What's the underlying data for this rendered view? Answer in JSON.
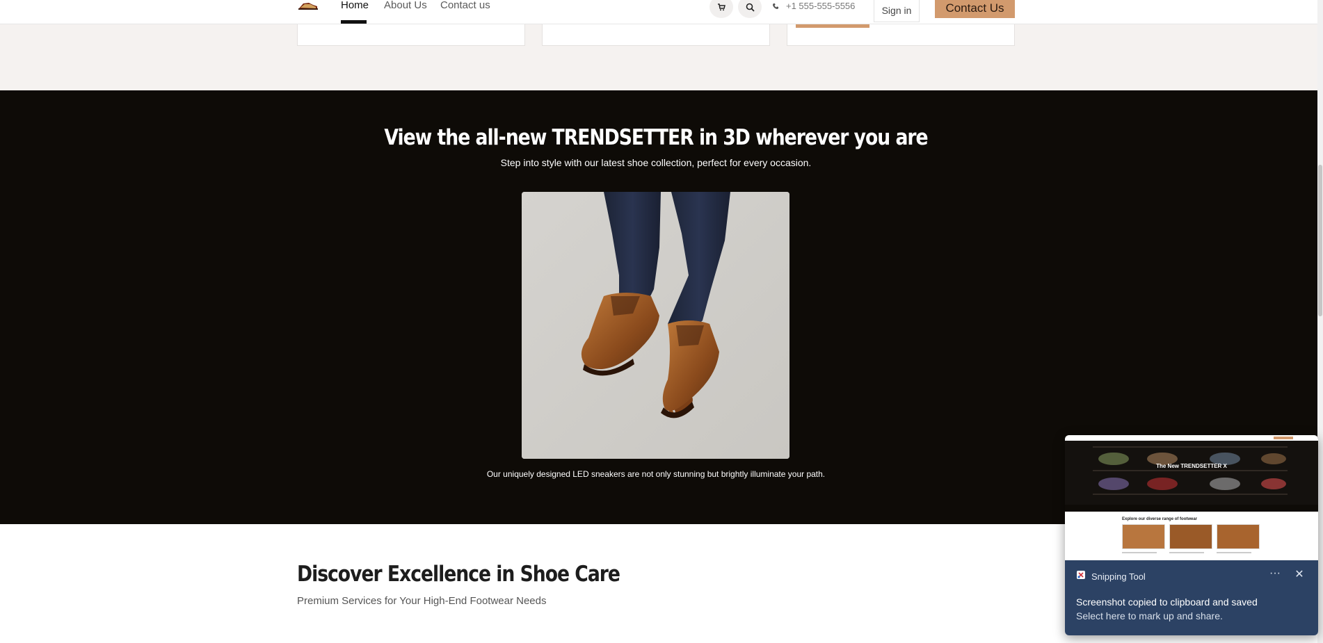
{
  "header": {
    "nav": [
      {
        "label": "Home"
      },
      {
        "label": "About Us"
      },
      {
        "label": "Contact us"
      }
    ],
    "phone": "+1 555-555-5556",
    "signin_label": "Sign in",
    "contact_label": "Contact Us",
    "accent_color": "#d29a6d"
  },
  "feature": {
    "title": "View the all-new TRENDSETTER in 3D wherever you are",
    "subtitle": "Step into style with our latest shoe collection, perfect for every occasion.",
    "caption": "Our uniquely designed LED sneakers are not only stunning but brightly illuminate your path.",
    "image_icon": "shoe-photo"
  },
  "discover": {
    "title": "Discover Excellence in Shoe Care",
    "subtitle": "Premium Services for Your High-End Footwear Needs"
  },
  "toast": {
    "app_name": "Snipping Tool",
    "message": "Screenshot copied to clipboard and saved",
    "action": "Select here to mark up and share.",
    "preview": {
      "hero_title": "The New TRENDSETTER X",
      "section_title": "Explore our diverse range of footwear"
    }
  }
}
